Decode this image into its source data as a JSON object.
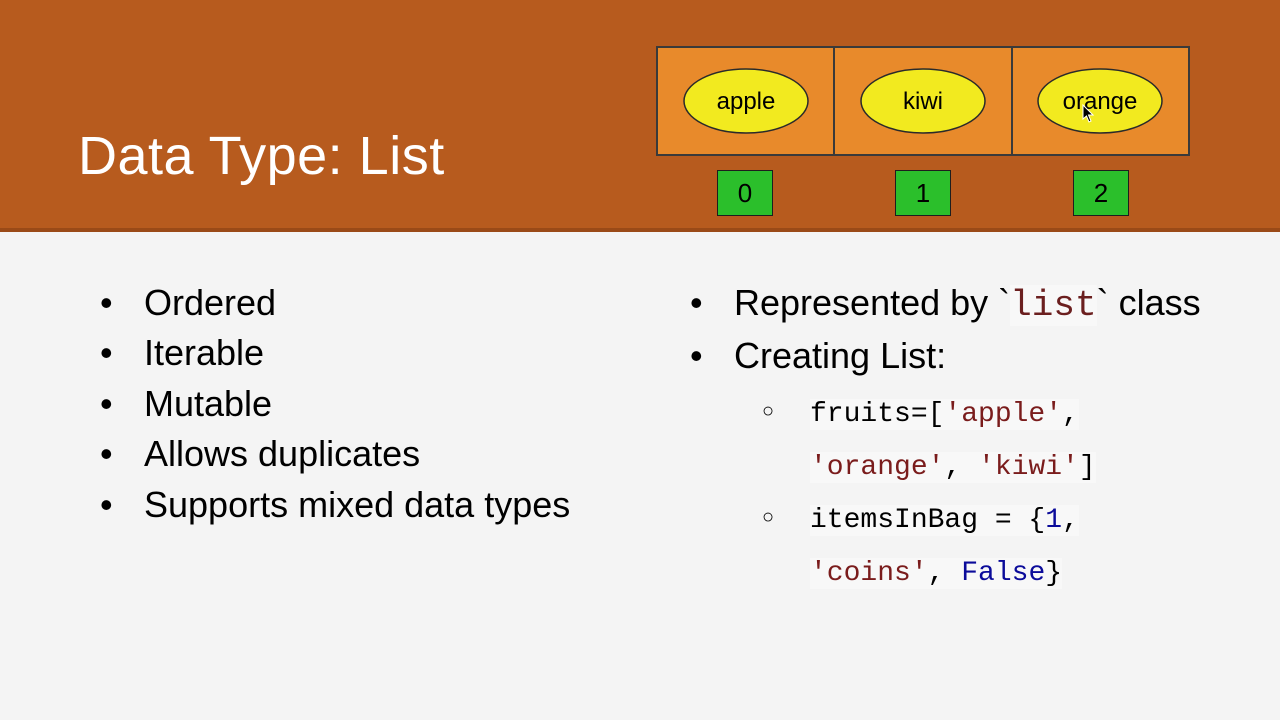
{
  "header": {
    "title": "Data Type: List"
  },
  "diagram": {
    "items": [
      "apple",
      "kiwi",
      "orange"
    ],
    "indices": [
      "0",
      "1",
      "2"
    ]
  },
  "left_bullets": [
    "Ordered",
    "Iterable",
    "Mutable",
    "Allows duplicates",
    "Supports mixed data types"
  ],
  "right": {
    "class_line_prefix": "Represented by `",
    "class_name": "list",
    "class_line_suffix": "` class",
    "creating_label": "Creating List:",
    "code1": {
      "p1": "fruits=[",
      "s1": "'apple'",
      "c1": ", ",
      "s2": "'orange'",
      "c2": ", ",
      "s3": "'kiwi'",
      "p2": "]"
    },
    "code2": {
      "p1": "itemsInBag = {",
      "n1": "1",
      "c1": ", ",
      "s1": "'coins'",
      "c2": ", ",
      "k1": "False",
      "p2": "}"
    }
  }
}
